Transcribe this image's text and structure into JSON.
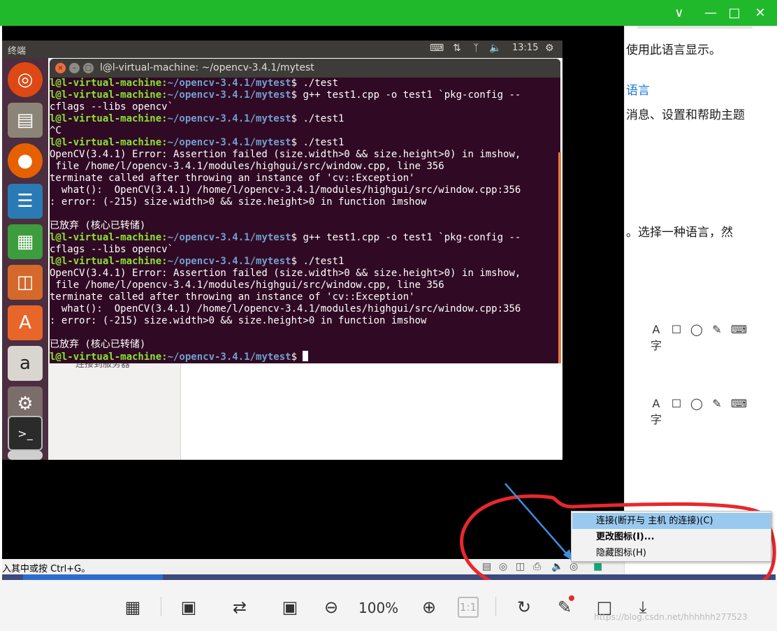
{
  "viewer": {
    "title_controls": {
      "collapse": "∨",
      "minimize": "—",
      "maximize": "□",
      "close": "✕"
    },
    "toolbar": {
      "zoom_level": "100%",
      "actual_size": "1:1",
      "icons": [
        "thumbnail-grid-icon",
        "ocr-icon",
        "translate-icon",
        "fit-window-icon",
        "zoom-out-icon",
        "zoom-in-icon",
        "actual-size-icon",
        "rotate-icon",
        "edit-icon",
        "crop-icon",
        "download-icon"
      ]
    },
    "watermark": "https://blog.csdn.net/hhhhhh277523"
  },
  "settings_page": {
    "line1": "使用此语言显示。",
    "link": "语言",
    "line2": "消息、设置和帮助主题",
    "line3": "。选择一种语言，然",
    "feature_icons": [
      "A字",
      "☐",
      "◯",
      "✎",
      "⌨"
    ]
  },
  "ubuntu": {
    "panel": {
      "app_label": "终端",
      "time": "13:15"
    },
    "launcher": [
      "ubuntu-dash-icon",
      "files-icon",
      "firefox-icon",
      "writer-icon",
      "calc-icon",
      "impress-icon",
      "software-center-icon",
      "amazon-icon",
      "system-settings-icon",
      "terminal-icon",
      "dvd-icon"
    ],
    "bg_window": {
      "sidebar_item": "连接到服务器"
    },
    "terminal": {
      "title": "l@l-virtual-machine: ~/opencv-3.4.1/mytest",
      "user_host": "l@l-virtual-machine",
      "path": "~/opencv-3.4.1/mytest",
      "lines": [
        {
          "type": "prompt",
          "cmd": " ./test"
        },
        {
          "type": "prompt",
          "cmd": " g++ test1.cpp -o test1 `pkg-config --"
        },
        {
          "type": "text",
          "text": "cflags --libs opencv`"
        },
        {
          "type": "prompt",
          "cmd": " ./test1"
        },
        {
          "type": "text",
          "text": "^C"
        },
        {
          "type": "prompt",
          "cmd": " ./test1"
        },
        {
          "type": "text",
          "text": "OpenCV(3.4.1) Error: Assertion failed (size.width>0 && size.height>0) in imshow,"
        },
        {
          "type": "text",
          "text": " file /home/l/opencv-3.4.1/modules/highgui/src/window.cpp, line 356"
        },
        {
          "type": "text",
          "text": "terminate called after throwing an instance of 'cv::Exception'"
        },
        {
          "type": "text",
          "text": "  what():  OpenCV(3.4.1) /home/l/opencv-3.4.1/modules/highgui/src/window.cpp:356"
        },
        {
          "type": "text",
          "text": ": error: (-215) size.width>0 && size.height>0 in function imshow"
        },
        {
          "type": "text",
          "text": ""
        },
        {
          "type": "text",
          "text": "已放弃 (核心已转储)"
        },
        {
          "type": "prompt",
          "cmd": " g++ test1.cpp -o test1 `pkg-config --"
        },
        {
          "type": "text",
          "text": "cflags --libs opencv`"
        },
        {
          "type": "prompt",
          "cmd": " ./test1"
        },
        {
          "type": "text",
          "text": "OpenCV(3.4.1) Error: Assertion failed (size.width>0 && size.height>0) in imshow,"
        },
        {
          "type": "text",
          "text": " file /home/l/opencv-3.4.1/modules/highgui/src/window.cpp, line 356"
        },
        {
          "type": "text",
          "text": "terminate called after throwing an instance of 'cv::Exception'"
        },
        {
          "type": "text",
          "text": "  what():  OpenCV(3.4.1) /home/l/opencv-3.4.1/modules/highgui/src/window.cpp:356"
        },
        {
          "type": "text",
          "text": ": error: (-215) size.width>0 && size.height>0 in function imshow"
        },
        {
          "type": "text",
          "text": ""
        },
        {
          "type": "text",
          "text": "已放弃 (核心已转储)"
        },
        {
          "type": "prompt_cursor",
          "cmd": " "
        }
      ]
    }
  },
  "vmware": {
    "status_hint": "入其中或按 Ctrl+G。",
    "context_menu": {
      "items": [
        {
          "label": "连接(断开与 主机 的连接)(C)",
          "highlighted": true,
          "bold": false
        },
        {
          "label": "更改图标(I)...",
          "highlighted": false,
          "bold": true
        },
        {
          "label": "隐藏图标(H)",
          "highlighted": false,
          "bold": false
        }
      ]
    }
  },
  "colors": {
    "viewer_title": "#21b92c",
    "terminal_bg": "#300a24",
    "prompt_user": "#8ae234",
    "prompt_path": "#729fcf",
    "annotation_red": "#e8282d",
    "annotation_arrow": "#3d8fe0"
  }
}
